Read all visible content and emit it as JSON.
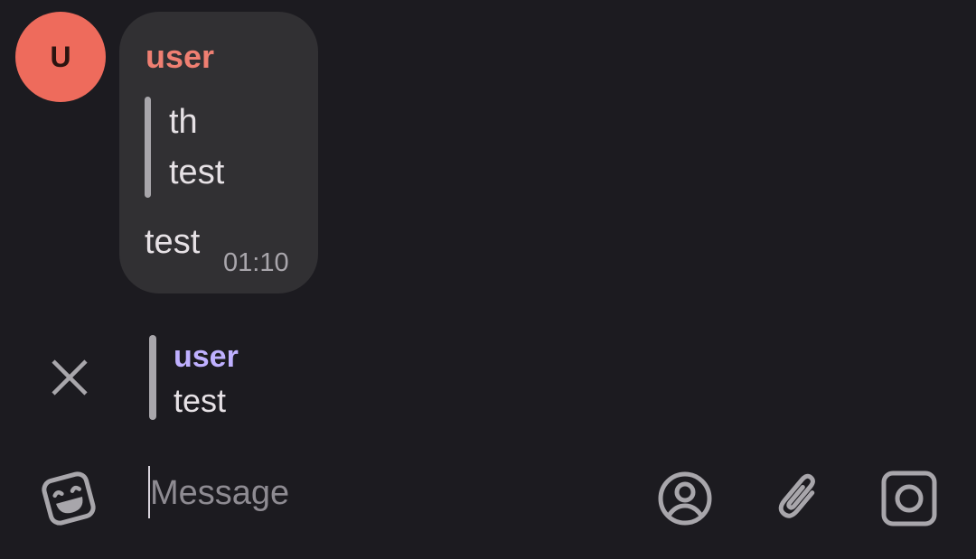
{
  "message": {
    "avatar_initial": "U",
    "sender": "user",
    "quoted_lines": [
      "th",
      "test"
    ],
    "body": "test",
    "time": "01:10"
  },
  "reply_preview": {
    "sender": "user",
    "text": "test"
  },
  "composer": {
    "placeholder": "Message"
  },
  "icons": {
    "close": "close-icon",
    "emoji": "sticker-emoji-icon",
    "profile": "account-circle-icon",
    "attach": "paperclip-icon",
    "camera": "camera-icon"
  },
  "colors": {
    "background": "#1c1b20",
    "bubble": "#313033",
    "avatar": "#ee6b5c",
    "sender_name": "#ef7f72",
    "reply_sender": "#bfb0ff",
    "icon": "#a8a6ab"
  }
}
